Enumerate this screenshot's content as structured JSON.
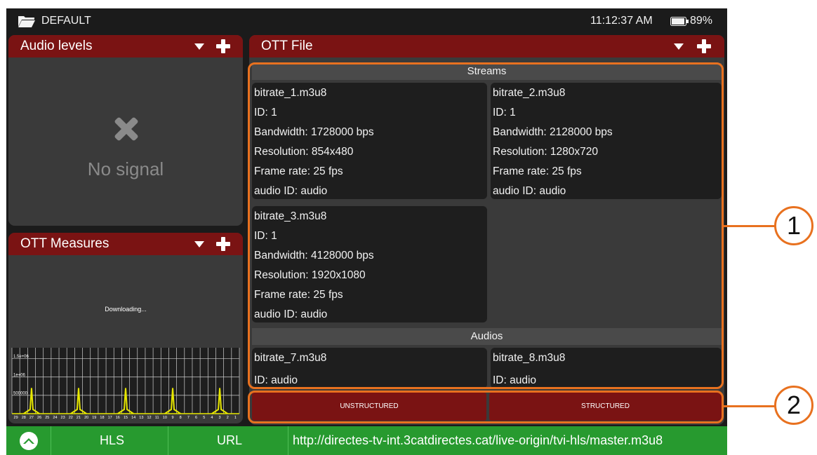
{
  "status_bar": {
    "profile": "DEFAULT",
    "time": "11:12:37 AM",
    "battery": "89%"
  },
  "audio_panel": {
    "title": "Audio levels",
    "message": "No signal"
  },
  "measures_panel": {
    "title": "OTT Measures",
    "status": "Downloading...",
    "chart_data": {
      "type": "bar",
      "ytick_labels": [
        "1.5e+06",
        "1e+06",
        "500000"
      ],
      "xtick_labels": [
        "29",
        "28",
        "27",
        "26",
        "25",
        "24",
        "23",
        "22",
        "21",
        "20",
        "19",
        "18",
        "17",
        "16",
        "15",
        "14",
        "13",
        "12",
        "11",
        "10",
        "9",
        "8",
        "7",
        "6",
        "5",
        "4",
        "3",
        "2",
        "1"
      ],
      "ylim": [
        0,
        1800000
      ],
      "spike_values": [
        700000,
        700000,
        700000,
        700000,
        700000
      ],
      "spike_slots": [
        "27",
        "21",
        "15",
        "9",
        "3"
      ],
      "line_color": "#e6e600",
      "grid": true
    }
  },
  "ott_panel": {
    "title": "OTT File",
    "streams_label": "Streams",
    "audios_label": "Audios",
    "streams": [
      {
        "name": "bitrate_1.m3u8",
        "id": "ID: 1",
        "bandwidth": "Bandwidth: 1728000 bps",
        "resolution": "Resolution: 854x480",
        "frame_rate": "Frame rate: 25 fps",
        "audio_id": "audio ID: audio"
      },
      {
        "name": "bitrate_2.m3u8",
        "id": "ID: 1",
        "bandwidth": "Bandwidth: 2128000 bps",
        "resolution": "Resolution: 1280x720",
        "frame_rate": "Frame rate: 25 fps",
        "audio_id": "audio ID: audio"
      },
      {
        "name": "bitrate_3.m3u8",
        "id": "ID: 1",
        "bandwidth": "Bandwidth: 4128000 bps",
        "resolution": "Resolution: 1920x1080",
        "frame_rate": "Frame rate: 25 fps",
        "audio_id": "audio ID: audio"
      }
    ],
    "audios": [
      {
        "name": "bitrate_7.m3u8",
        "id": "ID: audio"
      },
      {
        "name": "bitrate_8.m3u8",
        "id": "ID: audio"
      }
    ],
    "buttons": {
      "unstructured": "UNSTRUCTURED",
      "structured": "STRUCTURED"
    }
  },
  "bottom_bar": {
    "protocol": "HLS",
    "source": "URL",
    "url": "http://directes-tv-int.3catdirectes.cat/live-origin/tvi-hls/master.m3u8"
  },
  "callouts": {
    "first": "1",
    "second": "2"
  },
  "colors": {
    "header_red": "#7a1313",
    "panel_gray": "#3a3a3a",
    "card_dark": "#1e1e1e",
    "bottom_green": "#279a2f",
    "callout_orange": "#e8711f"
  }
}
